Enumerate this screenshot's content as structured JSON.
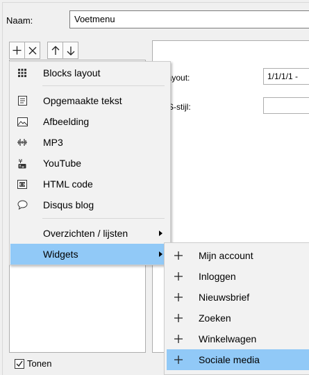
{
  "form": {
    "name_label": "Naam:",
    "name_value": "Voetmenu",
    "layout_label": "Layout:",
    "layout_value": "1/1/1/1 -",
    "css_label": "SS-stijl:",
    "css_value": "",
    "show_label": "Tonen",
    "show_checked": true
  },
  "toolbar": {
    "buttons": [
      {
        "name": "add",
        "icon": "plus-icon"
      },
      {
        "name": "delete",
        "icon": "x-icon"
      },
      {
        "name": "move-up",
        "icon": "arrow-up-icon"
      },
      {
        "name": "move-down",
        "icon": "arrow-down-icon"
      }
    ]
  },
  "menu": {
    "items": [
      {
        "label": "Blocks layout",
        "icon": "grid-blocks-icon"
      },
      {
        "label": "Opgemaakte tekst",
        "icon": "formatted-text-icon"
      },
      {
        "label": "Afbeelding",
        "icon": "image-icon"
      },
      {
        "label": "MP3",
        "icon": "audio-wave-icon"
      },
      {
        "label": "YouTube",
        "icon": "youtube-icon"
      },
      {
        "label": "HTML code",
        "icon": "html-code-icon"
      },
      {
        "label": "Disqus blog",
        "icon": "speech-bubble-icon"
      },
      {
        "label": "Overzichten / lijsten",
        "icon": "",
        "submenu": true
      },
      {
        "label": "Widgets",
        "icon": "",
        "submenu": true,
        "highlighted": true
      }
    ]
  },
  "submenu": {
    "items": [
      {
        "label": "Mijn account"
      },
      {
        "label": "Inloggen"
      },
      {
        "label": "Nieuwsbrief"
      },
      {
        "label": "Zoeken"
      },
      {
        "label": "Winkelwagen"
      },
      {
        "label": "Sociale media",
        "highlighted": true
      }
    ]
  },
  "colors": {
    "highlight": "#91c9f7",
    "menu_bg": "#f2f2f2",
    "window_bg": "#f0f0f0"
  }
}
